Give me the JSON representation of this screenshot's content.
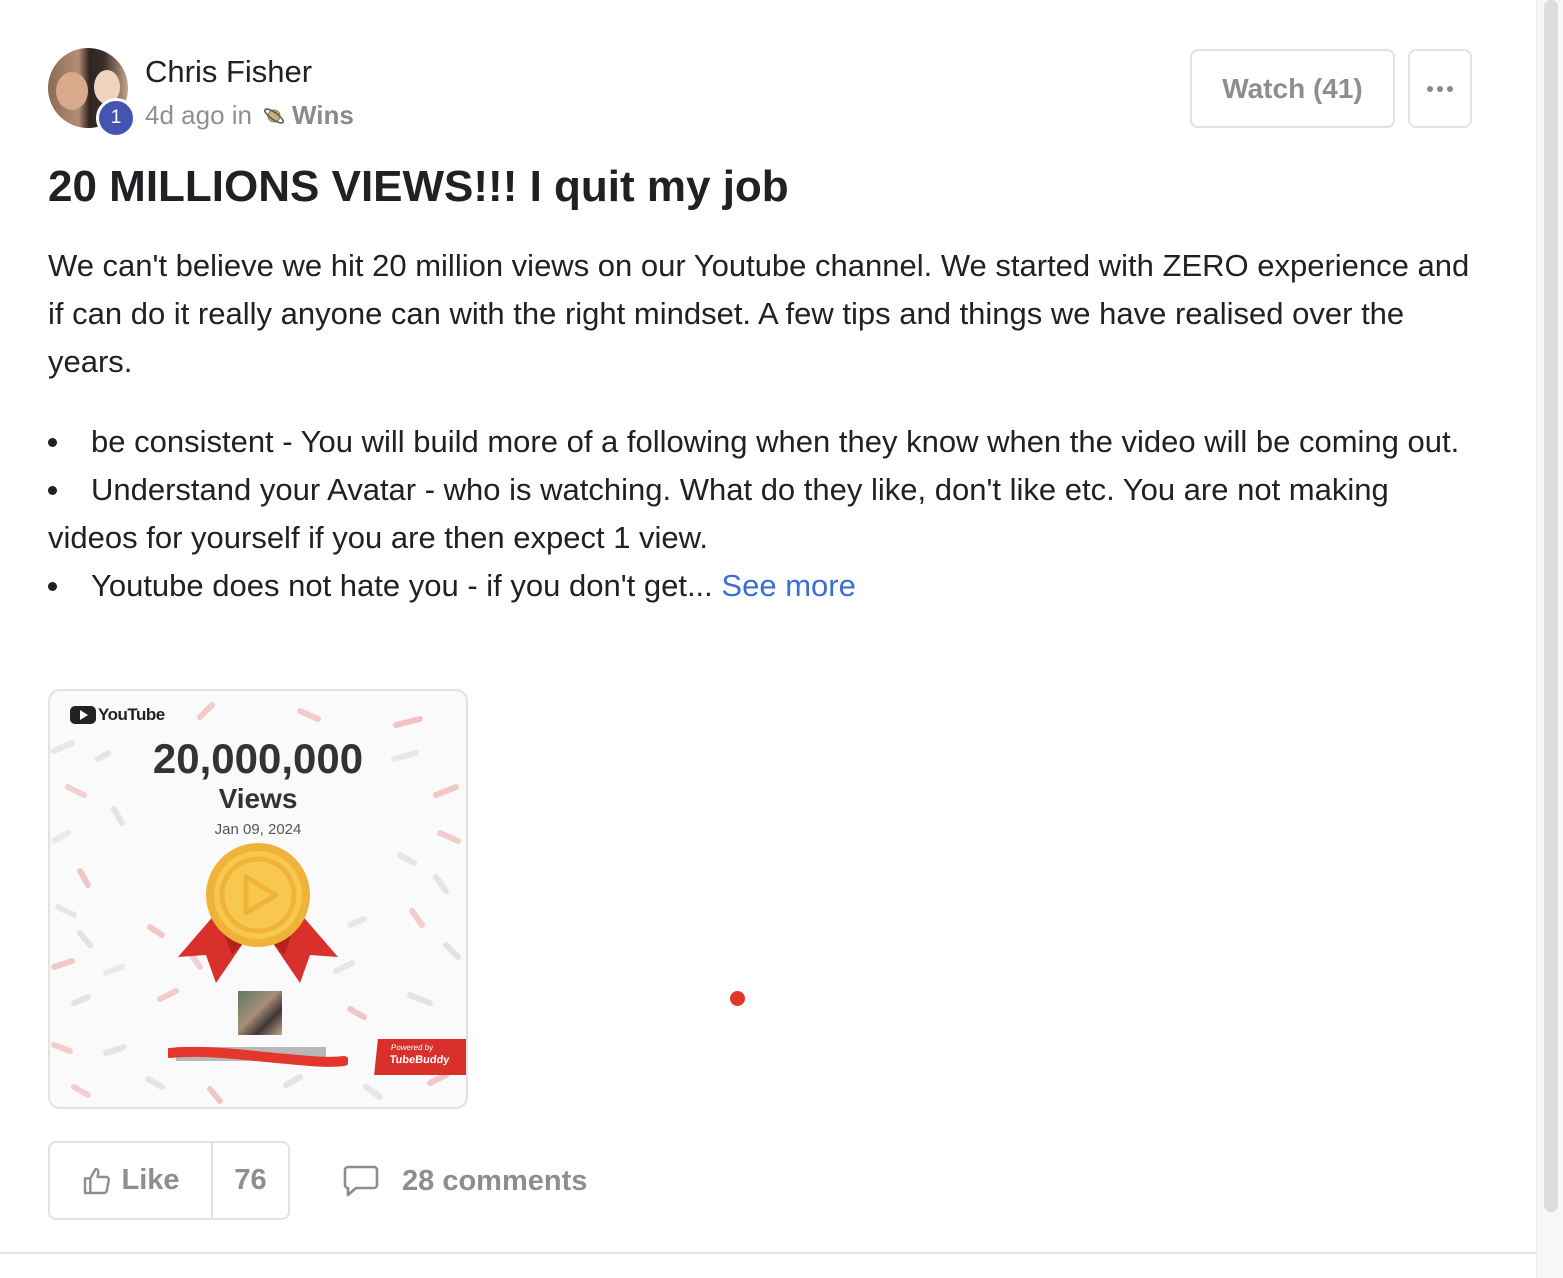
{
  "author": {
    "name": "Chris Fisher",
    "level": "1",
    "avatar_icon": "author-avatar-photo"
  },
  "meta": {
    "time_ago": "4d ago in",
    "category_icon": "saturn-icon",
    "category": "Wins"
  },
  "actions": {
    "watch_label": "Watch (41)",
    "more_icon": "ellipsis-icon"
  },
  "post": {
    "title": "20 MILLIONS VIEWS!!! I quit my job",
    "body": "We can't believe we hit 20 million views on our Youtube channel. We started with ZERO experience and if can do it really anyone can with the right mindset. A few tips and things we have realised over the years.",
    "bullets": [
      "be consistent - You will build more of a following when they know when the video will be coming out.",
      "Understand your Avatar - who is watching. What do they like, don't like etc. You are not making videos for yourself if you are then expect 1 view.",
      "Youtube does not hate you - if you don't get..."
    ],
    "see_more": "See more"
  },
  "attachment": {
    "platform": "YouTube",
    "milestone": "20,000,000",
    "milestone_label": "Views",
    "date": "Jan 09, 2024",
    "powered_by": "Powered by",
    "powered_brand": "TubeBuddy",
    "medal_icon": "gold-medal-play-icon"
  },
  "footer": {
    "like_label": "Like",
    "like_count": "76",
    "comments_label": "28 comments"
  },
  "colors": {
    "accent_link": "#3a6fd8",
    "level_badge": "#4554b0",
    "red_dot": "#e5362c",
    "muted_text": "#8e8e8e"
  }
}
